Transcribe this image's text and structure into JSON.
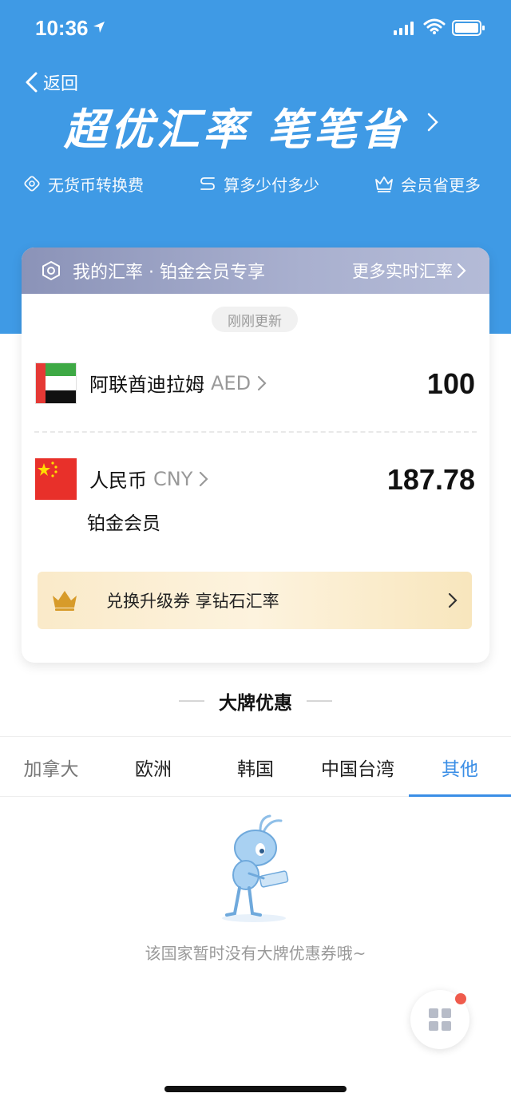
{
  "status_bar": {
    "time": "10:36"
  },
  "nav": {
    "back_label": "返回"
  },
  "hero": {
    "title": "超优汇率 笔笔省",
    "features": [
      "无货币转换费",
      "算多少付多少",
      "会员省更多"
    ]
  },
  "rate_card": {
    "header_title": "我的汇率 · 铂金会员专享",
    "more_link": "更多实时汇率",
    "updated_pill": "刚刚更新",
    "from": {
      "name": "阿联酋迪拉姆",
      "code": "AED",
      "amount": "100"
    },
    "to": {
      "name": "人民币",
      "code": "CNY",
      "amount": "187.78"
    },
    "member_label": "铂金会员",
    "upgrade_banner": "兑换升级券 享钻石汇率"
  },
  "brand_section": {
    "title": "大牌优惠",
    "tabs": [
      "加拿大",
      "欧洲",
      "韩国",
      "中国台湾",
      "其他"
    ],
    "active_tab": "其他",
    "empty_text": "该国家暂时没有大牌优惠券哦~"
  },
  "colors": {
    "hero_blue": "#3f9ae5",
    "accent_blue": "#3a8ee6",
    "badge_red": "#ef5b4c"
  }
}
